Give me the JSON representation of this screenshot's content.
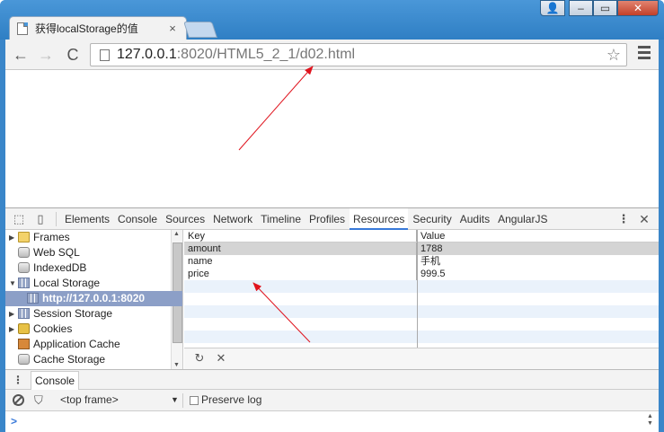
{
  "window": {
    "tab_title": "获得localStorage的值",
    "tab_close": "×",
    "user_btn": "👤",
    "minimize": "–",
    "maximize": "▭",
    "close": "✕"
  },
  "toolbar": {
    "back": "←",
    "forward": "→",
    "reload": "C",
    "url_host": "127.0.0.1",
    "url_rest": ":8020/HTML5_2_1/d02.html",
    "star": "☆"
  },
  "devtools": {
    "tabs": [
      "Elements",
      "Console",
      "Sources",
      "Network",
      "Timeline",
      "Profiles",
      "Resources",
      "Security",
      "Audits",
      "AngularJS"
    ],
    "active_tab": "Resources",
    "more": "⋮",
    "close": "✕",
    "sidebar": [
      {
        "label": "Frames",
        "icon": "folder-icon",
        "arrow": "▶"
      },
      {
        "label": "Web SQL",
        "icon": "database-icon",
        "arrow": ""
      },
      {
        "label": "IndexedDB",
        "icon": "database-icon",
        "arrow": ""
      },
      {
        "label": "Local Storage",
        "icon": "storage-grid-icon",
        "arrow": "▼"
      },
      {
        "label": "http://127.0.0.1:8020",
        "icon": "storage-grid-icon",
        "arrow": "",
        "selected": true
      },
      {
        "label": "Session Storage",
        "icon": "storage-grid-icon",
        "arrow": "▶"
      },
      {
        "label": "Cookies",
        "icon": "cookie-icon",
        "arrow": "▶"
      },
      {
        "label": "Application Cache",
        "icon": "app-cache-icon",
        "arrow": ""
      },
      {
        "label": "Cache Storage",
        "icon": "database-icon",
        "arrow": ""
      }
    ],
    "grid": {
      "columns": [
        "Key",
        "Value"
      ],
      "rows": [
        {
          "key": "amount",
          "value": "1788"
        },
        {
          "key": "name",
          "value": "手机"
        },
        {
          "key": "price",
          "value": "999.5"
        }
      ]
    },
    "grid_footer": {
      "refresh": "↻",
      "delete": "✕"
    },
    "drawer": {
      "dots": "⋮",
      "tab": "Console"
    },
    "console": {
      "frame": "<top frame>",
      "frame_arrow": "▼",
      "filter": "⛉",
      "preserve_log": "Preserve log",
      "prompt": ">"
    }
  },
  "colors": {
    "annotation_arrow": "#e0141e",
    "active_tab_underline": "#3879d9",
    "selected_row": "#8c9fc7"
  }
}
